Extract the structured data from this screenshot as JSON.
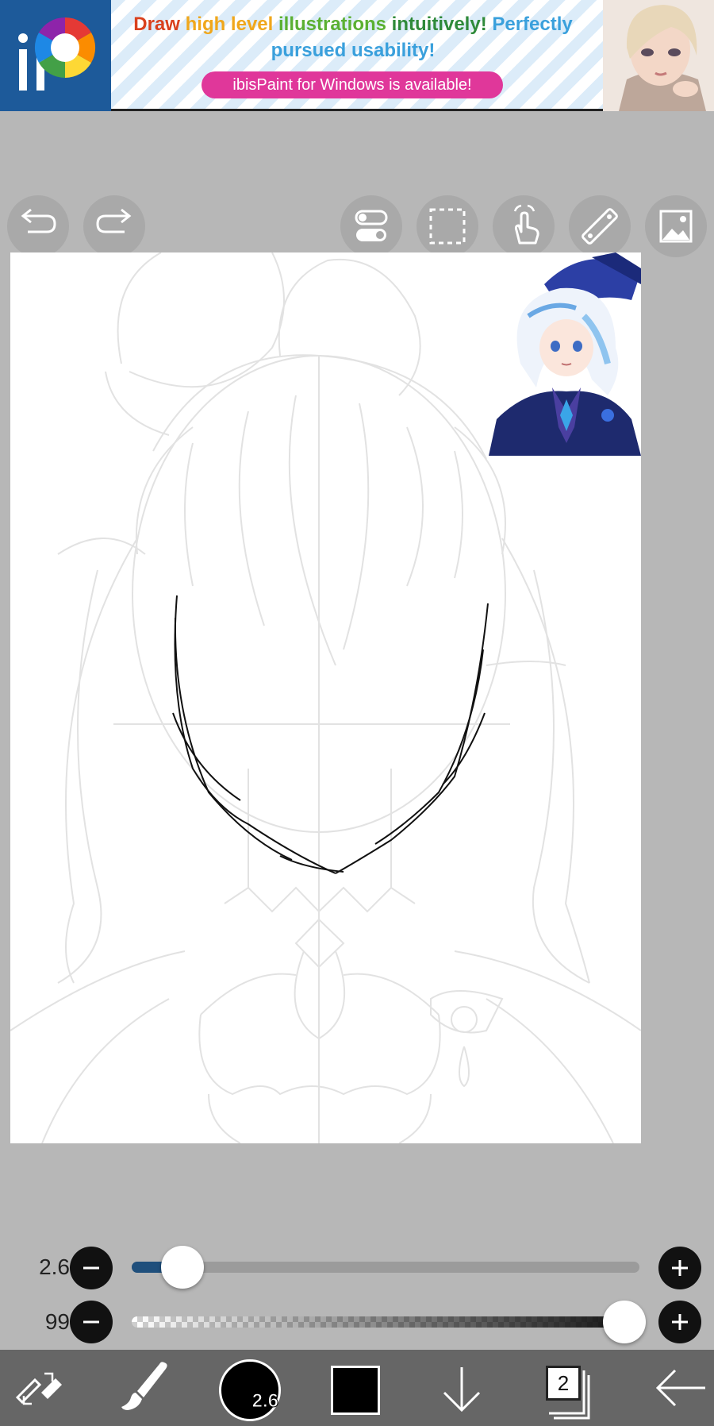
{
  "ad": {
    "logo_text": "iP",
    "headline_segments": [
      {
        "text": "Draw ",
        "color": "#d9411e"
      },
      {
        "text": "high level ",
        "color": "#f0a71c"
      },
      {
        "text": "illustrations ",
        "color": "#5bb032"
      },
      {
        "text": "intuitively! ",
        "color": "#2f8a3a"
      },
      {
        "text": "Perfectly pursued usability!",
        "color": "#3aa0dc"
      }
    ],
    "cta_label": "ibisPaint for Windows is available!"
  },
  "toolbar": {
    "buttons": [
      {
        "name": "undo",
        "icon": "undo-arrow-icon"
      },
      {
        "name": "redo",
        "icon": "redo-arrow-icon"
      },
      {
        "name": "toggle",
        "icon": "toggle-switch-icon"
      },
      {
        "name": "selection",
        "icon": "dashed-selection-icon"
      },
      {
        "name": "hand",
        "icon": "hand-touch-icon"
      },
      {
        "name": "ruler",
        "icon": "ruler-icon"
      },
      {
        "name": "reference",
        "icon": "image-icon"
      }
    ]
  },
  "brush": {
    "size": "2.6",
    "size_fraction": 0.1,
    "opacity": "99",
    "opacity_fraction": 0.99
  },
  "bottombar": {
    "layer_count": "2",
    "color": "#000000"
  },
  "colors": {
    "background": "#b7b7b7",
    "accent": "#1f4f7c",
    "ad_cta": "#e0379a",
    "bottom_bar": "#666666"
  }
}
